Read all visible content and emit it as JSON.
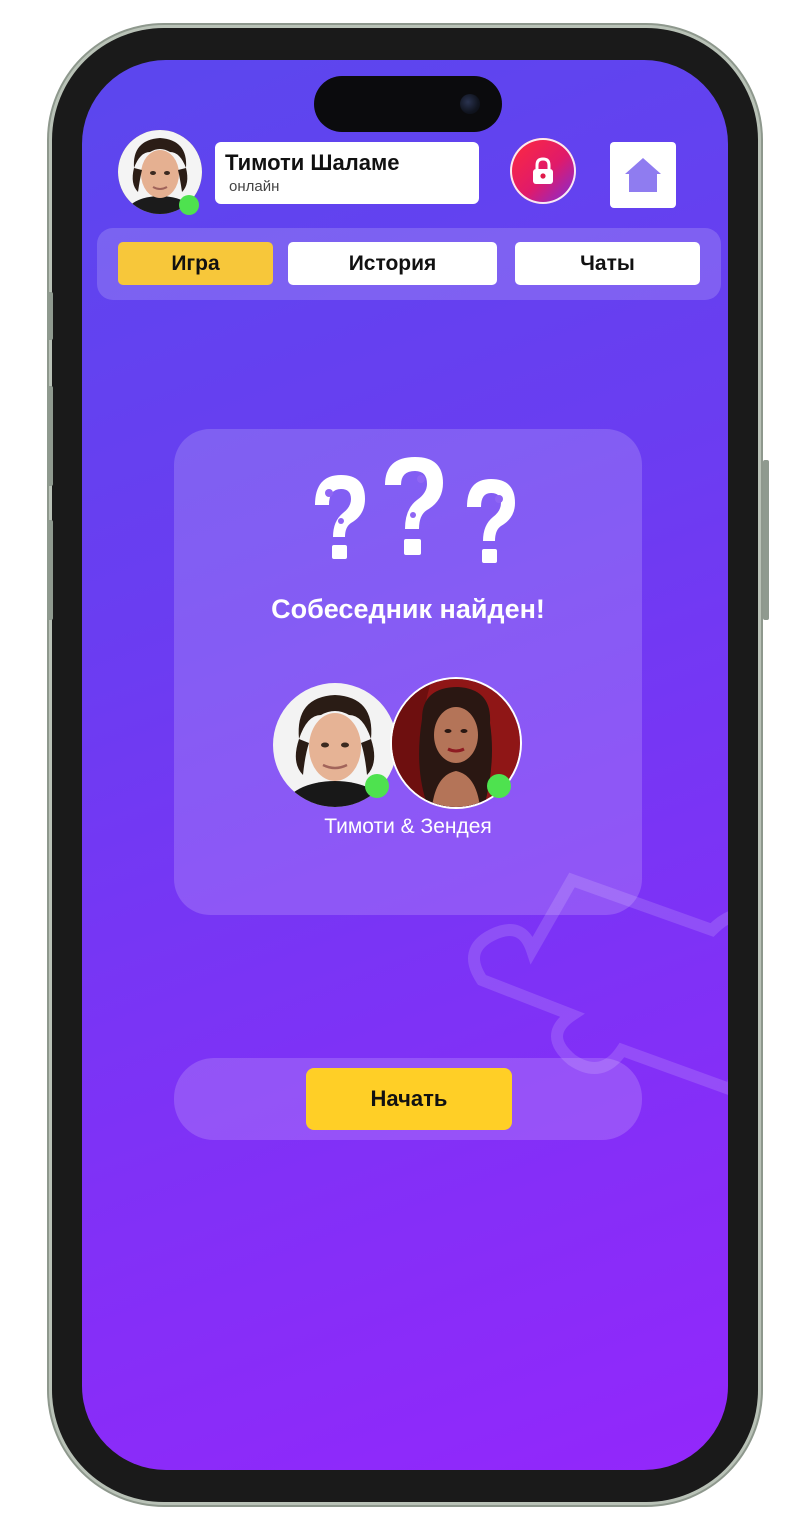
{
  "header": {
    "user_name": "Тимоти Шаламе",
    "user_status": "онлайн",
    "avatar": "user-avatar-photo"
  },
  "tabs": [
    {
      "label": "Игра",
      "active": true
    },
    {
      "label": "История",
      "active": false
    },
    {
      "label": "Чаты",
      "active": false
    }
  ],
  "icons": {
    "lock": "lock-icon",
    "home": "home-icon",
    "question_marks": "puzzle-question-mark-icon"
  },
  "match_card": {
    "title": "Собеседник найден!",
    "pair_names": "Тимоти & Зендея"
  },
  "actions": {
    "start_label": "Начать"
  },
  "colors": {
    "gradient_start": "#5b47ee",
    "gradient_end": "#9327fb",
    "active_tab": "#f7c73a",
    "start_button": "#ffcf26",
    "online_indicator": "#4ee24f",
    "lock_button": "#ff2a3c"
  }
}
